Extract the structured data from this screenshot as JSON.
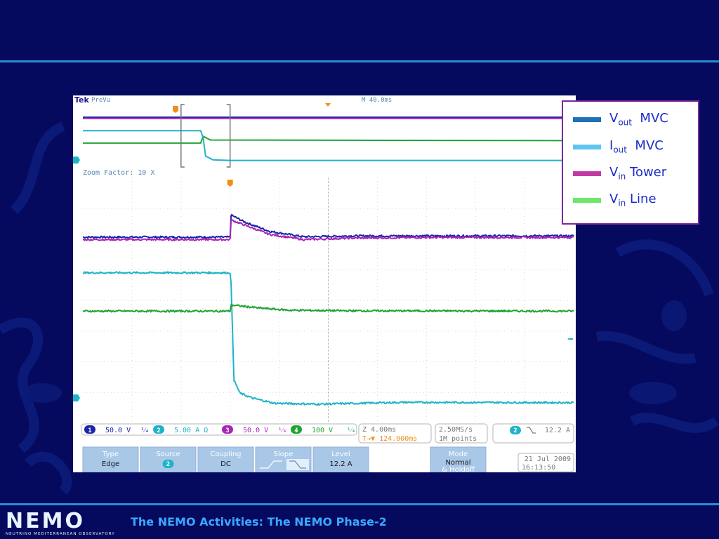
{
  "footer": {
    "title": "The NEMO Activities: The NEMO Phase-2",
    "logo_word": "NEMO",
    "logo_tagline": "NEUTRINO MEDITERRANEAN OBSERVATORY"
  },
  "colors": {
    "background": "#050a5e",
    "rule": "#2a8fd4",
    "legend_text": "#1a2cc4",
    "legend_border": "#7a2a9a",
    "vout": "#1f70b4",
    "iout": "#5ec4f5",
    "vin_tower": "#c13aa6",
    "vin_line": "#6ee86a"
  },
  "chart_data": {
    "type": "line",
    "title": "",
    "xlabel": "",
    "ylabel": "",
    "legend_position": "right",
    "legend": [
      {
        "main": "V",
        "sub": "out",
        "rest": "  MVC",
        "color": "#1f70b4"
      },
      {
        "main": "I",
        "sub": "out",
        "rest": "  MVC",
        "color": "#5ec4f5"
      },
      {
        "main": "V",
        "sub": "in",
        "rest": " Tower",
        "color": "#c13aa6"
      },
      {
        "main": "V",
        "sub": "in",
        "rest": " Line",
        "color": "#6ee86a"
      }
    ],
    "x_divisions": 10,
    "x_unit": "div",
    "xlim": [
      0,
      10
    ],
    "y_divisions": 8,
    "ylim": [
      0,
      8
    ],
    "trigger_x": 3.0,
    "grid": true,
    "series": [
      {
        "key": "ch1",
        "color": "#1d24a8",
        "x": [
          0,
          3.0,
          3.02,
          3.3,
          3.8,
          4.5,
          5.5,
          7,
          10
        ],
        "y": [
          6.06,
          6.06,
          6.78,
          6.55,
          6.25,
          6.07,
          6.1,
          6.1,
          6.1
        ]
      },
      {
        "key": "ch3",
        "color": "#a626b6",
        "x": [
          0,
          3.0,
          3.02,
          3.3,
          3.8,
          4.5,
          5.5,
          7,
          10
        ],
        "y": [
          5.98,
          5.98,
          6.62,
          6.45,
          6.15,
          5.98,
          6.03,
          6.05,
          6.05
        ]
      },
      {
        "key": "ch2",
        "color": "#1fb3c8",
        "x": [
          0,
          3.0,
          3.02,
          3.08,
          3.2,
          3.45,
          3.9,
          4.8,
          6.5,
          10
        ],
        "y": [
          4.9,
          4.9,
          4.55,
          1.4,
          0.98,
          0.82,
          0.65,
          0.62,
          0.68,
          0.67
        ]
      },
      {
        "key": "ch4",
        "color": "#1fa332",
        "x": [
          0,
          3.0,
          3.02,
          3.2,
          3.6,
          4.2,
          5.5,
          10
        ],
        "y": [
          3.65,
          3.65,
          3.85,
          3.82,
          3.75,
          3.68,
          3.66,
          3.65
        ]
      }
    ],
    "preview": {
      "brand": "Tek",
      "mode": "PreVu",
      "timebase": "M 40.0ms",
      "zoom_label": "Zoom Factor: 10 X",
      "window_start": 0.2,
      "window_end": 0.3,
      "series": [
        {
          "key": "ch1",
          "color": "#1d24a8",
          "x": [
            0,
            1
          ],
          "y": [
            0.83,
            0.83
          ]
        },
        {
          "key": "ch3",
          "color": "#a626b6",
          "x": [
            0,
            1
          ],
          "y": [
            0.81,
            0.81
          ]
        },
        {
          "key": "ch4",
          "color": "#1fa332",
          "x": [
            0,
            0.24,
            0.245,
            0.26,
            1
          ],
          "y": [
            0.41,
            0.41,
            0.52,
            0.46,
            0.45
          ]
        },
        {
          "key": "ch2",
          "color": "#1fb3c8",
          "x": [
            0,
            0.24,
            0.245,
            0.25,
            0.265,
            0.3,
            1
          ],
          "y": [
            0.61,
            0.61,
            0.5,
            0.2,
            0.14,
            0.13,
            0.13
          ]
        }
      ]
    },
    "channels": [
      {
        "num": "1",
        "value": "50.0 V",
        "suffix": "¹⁄₄",
        "color": "#1d24a8"
      },
      {
        "num": "2",
        "value": "5.00 A Ω",
        "suffix": "¹⁄₄",
        "color": "#1fb3c8"
      },
      {
        "num": "3",
        "value": "50.0 V",
        "suffix": "¹⁄₄",
        "color": "#a626b6"
      },
      {
        "num": "4",
        "value": "100 V",
        "suffix": "¹⁄₄",
        "color": "#1fa332"
      }
    ],
    "zoom_time": "Z 4.00ms",
    "zoom_offset": "T→▼ 124.000ms",
    "sample_rate": "2.50MS/s",
    "record_length": "1M points",
    "trigger_readout": {
      "channel": "2",
      "level": "12.2 A"
    },
    "menu": [
      {
        "top": "Type",
        "bottom": "Edge"
      },
      {
        "top": "Source",
        "bottom": "2"
      },
      {
        "top": "Coupling",
        "bottom": "DC"
      },
      {
        "top": "Slope",
        "bottom": ""
      },
      {
        "top": "Level",
        "bottom": "12.2 A"
      },
      {
        "top": "Mode",
        "bottom": "Normal",
        "extra": "& Holdoff"
      }
    ],
    "date": "21 Jul  2009",
    "time": "16:13:50"
  }
}
